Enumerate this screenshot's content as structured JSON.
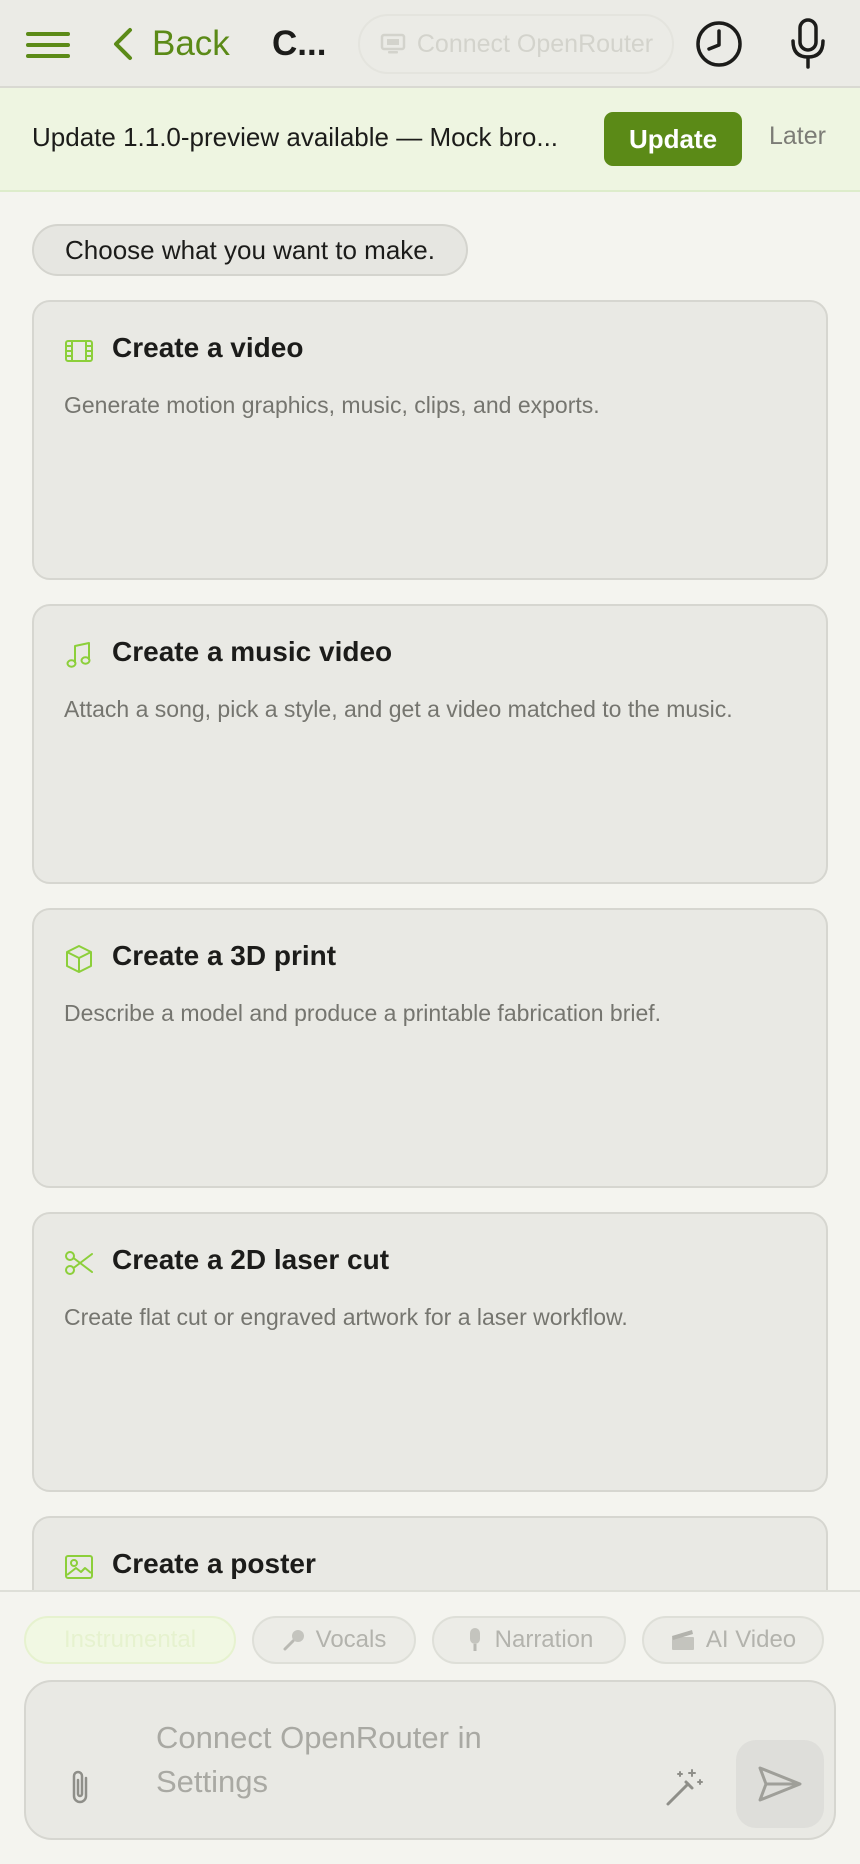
{
  "header": {
    "back_label": "Back",
    "title": "C...",
    "connect_label": "Connect OpenRouter"
  },
  "banner": {
    "message": "Update 1.1.0-preview available — Mock bro...",
    "update_label": "Update",
    "later_label": "Later"
  },
  "main": {
    "prompt": "Choose what you want to make.",
    "cards": [
      {
        "icon": "film-icon",
        "title": "Create a video",
        "description": "Generate motion graphics, music, clips, and exports."
      },
      {
        "icon": "music-note-icon",
        "title": "Create a music video",
        "description": "Attach a song, pick a style, and get a video matched to the music."
      },
      {
        "icon": "cube-icon",
        "title": "Create a 3D print",
        "description": "Describe a model and produce a printable fabrication brief."
      },
      {
        "icon": "scissors-icon",
        "title": "Create a 2D laser cut",
        "description": "Create flat cut or engraved artwork for a laser workflow."
      },
      {
        "icon": "image-icon",
        "title": "Create a poster",
        "description": ""
      }
    ]
  },
  "chips": [
    {
      "label": "Instrumental",
      "icon": "",
      "active": true
    },
    {
      "label": "Vocals",
      "icon": "microphone-icon",
      "active": false
    },
    {
      "label": "Narration",
      "icon": "microphone-icon",
      "active": false
    },
    {
      "label": "AI Video",
      "icon": "clapperboard-icon",
      "active": false
    }
  ],
  "composer": {
    "placeholder": "Connect OpenRouter in Settings"
  },
  "colors": {
    "accent": "#5b8a17",
    "icon_green": "#8ccf3a",
    "banner_bg": "#eef5e1",
    "background": "#f4f4ef"
  }
}
